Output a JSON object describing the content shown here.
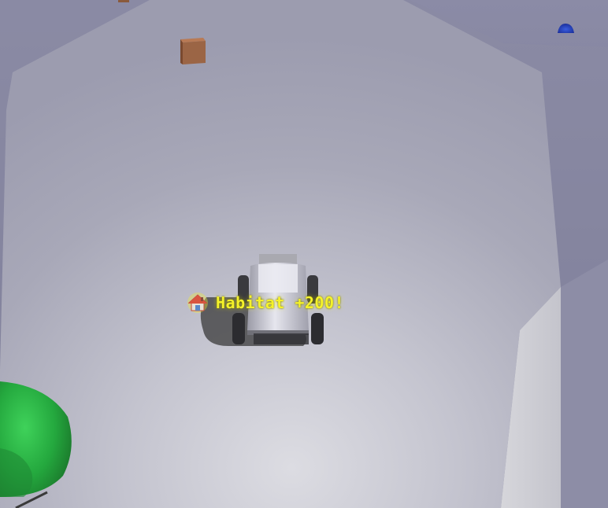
{
  "hud": {
    "popup_text": "Habitat +200!",
    "popup_icon": "house-icon",
    "popup_color": "#f5f22a"
  },
  "scene": {
    "ground_color": "#d8d8e0",
    "sky_color": "#7d7d98",
    "objects": [
      "rover",
      "crate",
      "crate-far",
      "blue-dome-marker",
      "green-dome-habitat"
    ]
  }
}
